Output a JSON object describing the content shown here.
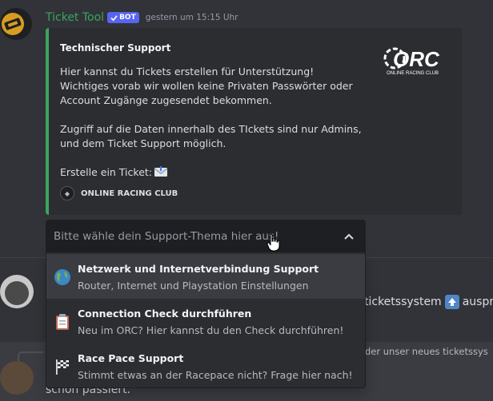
{
  "message": {
    "username": "Ticket Tool",
    "bot_badge": "BOT",
    "timestamp": "gestern um 15:15 Uhr"
  },
  "embed": {
    "title": "Technischer Support",
    "description": "Hier kannst du Tickets erstellen für Unterstützung!\nWichtiges vorab wir wollen keine Privaten Passwörter oder Account Zugänge zugesendet bekommen.\n\nZugriff auf die Daten innerhalb des TIckets sind nur Admins, und dem Ticket Support möglich.\n\nErstelle ein Ticket:",
    "thumbnail_logo": "ORC",
    "thumbnail_subtitle": "ONLINE RACING CLUB",
    "footer_text": "ONLINE RACING CLUB",
    "accent_color": "#3ba55c"
  },
  "select": {
    "placeholder": "Bitte wähle dein Support-Thema hier aus!",
    "expanded": true,
    "options": [
      {
        "emoji": "globe-icon",
        "label": "Netzwerk und Internetverbindung Support",
        "description": "Router, Internet und Playstation Einstellungen"
      },
      {
        "emoji": "clipboard-icon",
        "label": "Connection Check durchführen",
        "description": "Neu im ORC? Hier kannst du den Check durchführen!"
      },
      {
        "emoji": "checkered-flag-icon",
        "label": "Race Pace Support",
        "description": "Stimmt etwas an der Racepace nicht? Frage hier nach!"
      }
    ]
  },
  "background": {
    "line1_text": "ticketssystem",
    "line1_trailing": "auspr",
    "reply_preview": "der unser neues ticketssys",
    "line3_text": "schon passiert."
  }
}
